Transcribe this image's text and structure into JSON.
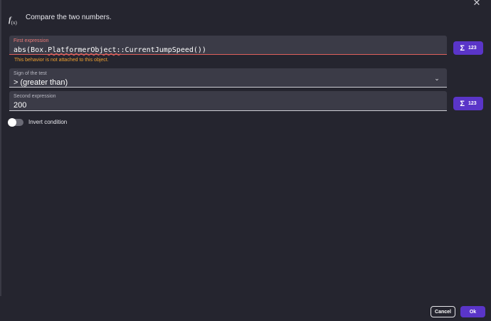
{
  "header": {
    "icon": "function-icon",
    "fx_main": "f",
    "fx_sub": "(x)",
    "description": "Compare the two numbers."
  },
  "first_expression": {
    "label": "First expression",
    "value_prefix": "abs(Box.",
    "value_error": "PlatformerObject:",
    "value_suffix": ":CurrentJumpSpeed())",
    "error": "This behavior is not attached to this object."
  },
  "sign": {
    "label": "Sign of the test",
    "value": "> (greater than)"
  },
  "second_expression": {
    "label": "Second expression",
    "value": "200"
  },
  "expression_button": {
    "sigma": "Σ",
    "number": "123"
  },
  "invert": {
    "label": "Invert condition",
    "checked": false
  },
  "footer": {
    "cancel": "Cancel",
    "ok": "Ok"
  },
  "colors": {
    "background": "#25252f",
    "field": "#3b3b47",
    "accent": "#5a35c8",
    "error": "#e0605c",
    "warning": "#f0a030"
  }
}
